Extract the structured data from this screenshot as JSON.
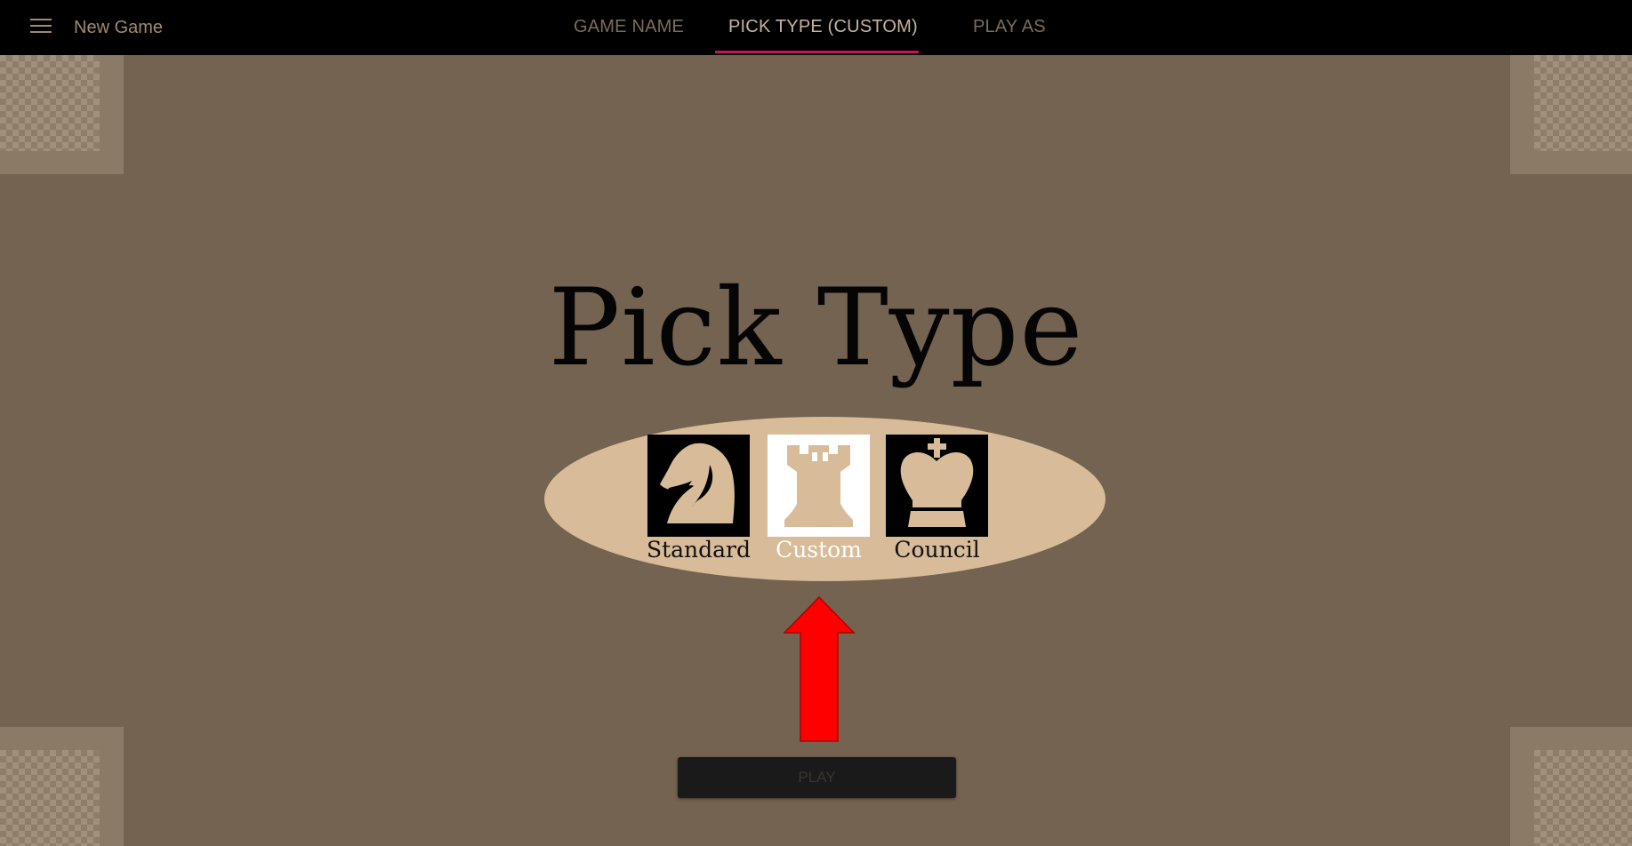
{
  "header": {
    "title": "New Game",
    "menu_icon": "hamburger-menu-icon",
    "tabs": [
      {
        "label": "GAME NAME",
        "active": false
      },
      {
        "label": "PICK TYPE (CUSTOM)",
        "active": true
      },
      {
        "label": "PLAY AS",
        "active": false
      }
    ],
    "active_color": "#c2185b"
  },
  "main": {
    "title": "Pick Type",
    "choices": [
      {
        "label": "Standard",
        "icon": "knight-icon",
        "selected": false
      },
      {
        "label": "Custom",
        "icon": "rook-icon",
        "selected": true
      },
      {
        "label": "Council",
        "icon": "king-icon",
        "selected": false
      }
    ],
    "annotation_icon": "red-up-arrow-icon",
    "play_label": "PLAY"
  },
  "colors": {
    "background": "#736350",
    "ellipse": "#d8bb98",
    "arrow": "#ff0000"
  }
}
